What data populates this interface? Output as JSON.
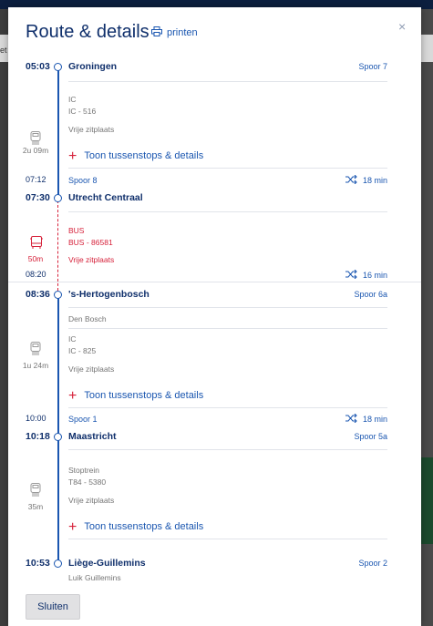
{
  "background": {
    "left_text": "et"
  },
  "modal": {
    "title": "Route & details",
    "print_label": "printen",
    "close_label": "×",
    "close_button_label": "Sluiten"
  },
  "stops": [
    {
      "time": "05:03",
      "station": "Groningen",
      "platform": "Spoor 7"
    },
    {
      "arrival": "07:12",
      "arrival_platform": "Spoor 8",
      "transfer": "18 min",
      "time": "07:30",
      "station": "Utrecht Centraal"
    },
    {
      "arrival": "08:20",
      "transfer": "16 min",
      "time": "08:36",
      "station": "'s-Hertogenbosch",
      "platform": "Spoor 6a",
      "alias": "Den Bosch"
    },
    {
      "arrival": "10:00",
      "arrival_platform": "Spoor 1",
      "transfer": "18 min",
      "time": "10:18",
      "station": "Maastricht",
      "platform": "Spoor 5a"
    },
    {
      "time": "10:53",
      "station": "Liège-Guillemins",
      "platform": "Spoor 2",
      "alias": "Luik Guillemins"
    }
  ],
  "legs": [
    {
      "type": "IC",
      "number": "IC - 516",
      "seat": "Vrije zitplaats",
      "duration": "2u 09m",
      "details_label": "Toon tussenstops & details",
      "icon": "train-icon"
    },
    {
      "type": "BUS",
      "number": "BUS - 86581",
      "seat": "Vrije zitplaats",
      "duration": "50m",
      "icon": "bus-icon",
      "color": "#d6213a"
    },
    {
      "type": "IC",
      "number": "IC - 825",
      "seat": "Vrije zitplaats",
      "duration": "1u 24m",
      "details_label": "Toon tussenstops & details",
      "icon": "train-icon"
    },
    {
      "type": "Stoptrein",
      "number": "T84 - 5380",
      "seat": "Vrije zitplaats",
      "duration": "35m",
      "details_label": "Toon tussenstops & details",
      "icon": "train-icon"
    }
  ],
  "colors": {
    "primary": "#0f2f6b",
    "link": "#1a56b0",
    "accent": "#d6213a",
    "muted": "#757575"
  }
}
